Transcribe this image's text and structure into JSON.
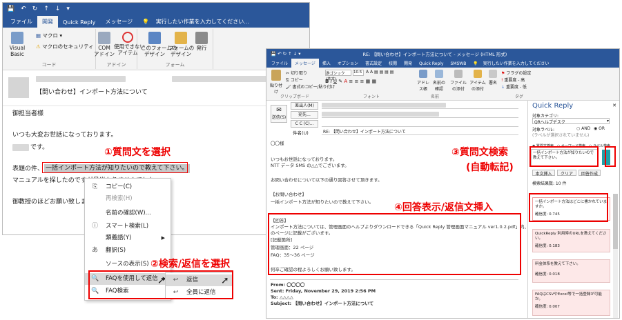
{
  "win1": {
    "tabs": [
      "ファイル",
      "開発",
      "Quick Reply",
      "メッセージ"
    ],
    "search": "実行したい作業を入力してください...",
    "ribbon": {
      "vb": "Visual Basic",
      "macro": "マクロ",
      "macro_sec": "マクロのセキュリティ",
      "grp_code": "コード",
      "com": "COM\nアドイン",
      "disabled": "使用できない\nアイテム",
      "grp_addin": "アドイン",
      "design_this": "このフォームの\nデザイン",
      "design_form": "フォームの\nデザイン",
      "publish": "発行",
      "grp_form": "フォーム"
    },
    "subject": "【問い合わせ】インポート方法について",
    "body": [
      "御担当者様",
      "いつも大変お世話になっております。",
      "です。",
      "表題の件、",
      "一括インポート方法が知りたいので教えて下さい。",
      "マニュアルを探したのですが見当たりませんでした。",
      "御教授のほどお願い致しま"
    ]
  },
  "ctx": {
    "items": [
      {
        "label": "コピー(C)",
        "icon": "copy-icon",
        "disabled": false
      },
      {
        "label": "再検索(H)",
        "icon": "",
        "disabled": true
      },
      {
        "label": "名前の確認(W)...",
        "icon": "",
        "disabled": false
      },
      {
        "label": "スマート検索(L)",
        "icon": "info-icon",
        "disabled": false
      },
      {
        "label": "類義語(Y)",
        "icon": "",
        "disabled": false,
        "submenu": true
      },
      {
        "label": "翻訳(S)",
        "icon": "translate-icon",
        "disabled": false
      },
      {
        "label": "ソースの表示(S)",
        "icon": "",
        "disabled": false
      },
      {
        "label": "FAQを使用して返信",
        "icon": "search-icon",
        "disabled": false,
        "submenu": true
      },
      {
        "label": "FAQ検索",
        "icon": "search-icon",
        "disabled": false
      }
    ],
    "sub": [
      "返信",
      "全員に返信"
    ]
  },
  "callouts": {
    "c1": "①質問文を選択",
    "c2": "②検索/返信を選択",
    "c3a": "③質問文検索",
    "c3b": "(自動転記)",
    "c4": "④回答表示/返信文挿入"
  },
  "win2": {
    "title": "RE: 【問い合わせ】インポート方法について - メッセージ (HTML 形式)",
    "tabs": [
      "ファイル",
      "メッセージ",
      "挿入",
      "オプション",
      "書式設定",
      "校閲",
      "開発",
      "Quick Reply",
      "SMSWB"
    ],
    "search": "実行したい作業を入力してください",
    "ribbon": {
      "clipboard": "クリップボード",
      "font": "フォント",
      "names": "名前",
      "tags": "タグ",
      "paste": "貼り付け",
      "cut": "切り取り",
      "copy": "コピー",
      "fmt": "書式のコピー/貼り付け",
      "font_name": "游ゴシック (本文)",
      "font_size": "10.5",
      "addr": "アドレス帳",
      "chk": "名前の確認",
      "attach_file": "ファイルの添付",
      "attach_item": "アイテムの添付",
      "sig": "署名",
      "flag": "フラグの設定",
      "high": "重要度 - 高",
      "low": "重要度 - 低"
    },
    "send": "送信(S)",
    "from_btn": "差出人(M)",
    "to_btn": "宛先...",
    "cc_btn": "C C (C)...",
    "subj_label": "件名(U)",
    "subj_val": "RE: 【問い合わせ】インポート方法について",
    "body": [
      "〇〇様",
      "いつもお世話になっております。",
      "NTT データ SMS の△△でございます。",
      "お問い合わせについて以下の通り回答させて頂きます。",
      "【お問い合わせ】",
      "一括インポート方法が知りたいので教えて下さい。",
      "【回答】",
      "インポート方法については、管理画面のヘルプよりダウンロードできる「Quick Reply 管理画面マニュアル ver1.0.2.pdf」内、以下",
      "のページに記載がございます。",
      "[記載箇所]",
      "管理画面：22 ページ",
      "FAQ：35～36 ページ",
      "何卒ご確認の程よろしくお願い致します。"
    ],
    "from": "From: 〇〇〇〇",
    "sent": "Sent: Friday, November 29, 2019 2:56 PM",
    "to": "To: △△△△",
    "subject": "Subject: 【問い合わせ】インポート方法について"
  },
  "qr": {
    "title": "Quick Reply",
    "cat_label": "対象カテゴリ:",
    "cat_val": "QRヘルプデスク",
    "label_label": "対象ラベル:",
    "and": "AND",
    "or": "OR",
    "label_hint": "(ラベルが選択されていません)",
    "mode1": "質問文検索",
    "mode2": "キーワード検索",
    "mode3": "ラベル検索",
    "query": "一括インポート方法が知りたいので教えて下さい。",
    "btn1": "本文挿入",
    "btn2": "クリア",
    "btn3": "回答作成",
    "count": "検索結果数: 10 件",
    "results": [
      {
        "q": "一括インポート方法はどこに書かれていますか。",
        "score": "確信度: 0.745"
      },
      {
        "q": "QuickReply 利用時のURLを教えてください。",
        "score": "確信度: 0.183"
      },
      {
        "q": "料金体系を教えて下さい。",
        "score": "確信度: 0.018"
      },
      {
        "q": "FAQはCSVやExcel等で一括登録が可能か。",
        "score": "確信度: 0.007"
      }
    ]
  },
  "colors": {
    "office_blue": "#2b579a",
    "callout": "#e00000",
    "qr_teal": "#1fa0a8"
  }
}
